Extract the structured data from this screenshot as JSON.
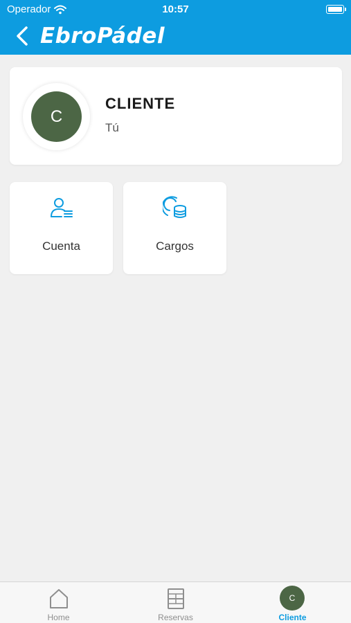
{
  "status_bar": {
    "carrier": "Operador",
    "time": "10:57"
  },
  "header": {
    "logo_text": "EbroPádel"
  },
  "profile": {
    "initial": "C",
    "name": "CLIENTE",
    "subtitle": "Tú"
  },
  "tiles": [
    {
      "label": "Cuenta",
      "icon": "account-card-icon"
    },
    {
      "label": "Cargos",
      "icon": "coins-icon"
    }
  ],
  "tab_bar": {
    "items": [
      {
        "label": "Home",
        "icon": "home-icon"
      },
      {
        "label": "Reservas",
        "icon": "court-icon"
      },
      {
        "label": "Cliente",
        "icon": "avatar",
        "initial": "C",
        "active": true
      }
    ]
  },
  "colors": {
    "brand": "#0d9ce0",
    "avatar": "#4c6645",
    "background": "#f0f0f0"
  }
}
